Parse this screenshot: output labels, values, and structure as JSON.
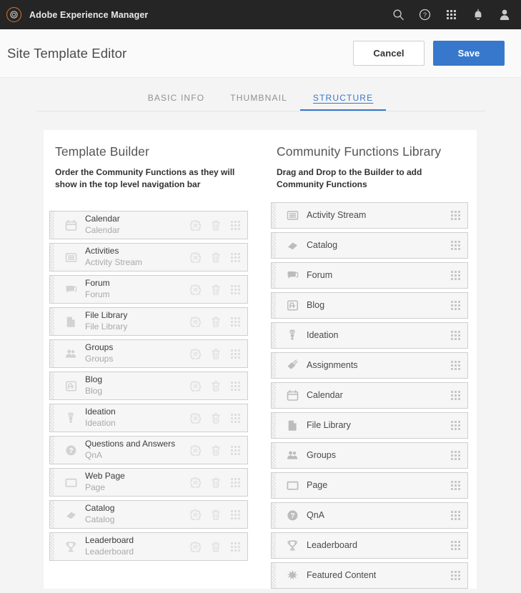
{
  "topbar": {
    "brand": "Adobe Experience Manager",
    "logo_color": "#e8731a",
    "icons": [
      {
        "name": "search-icon"
      },
      {
        "name": "help-icon"
      },
      {
        "name": "apps-grid-icon"
      },
      {
        "name": "notifications-bell-icon"
      },
      {
        "name": "user-avatar-icon"
      }
    ]
  },
  "header": {
    "title": "Site Template Editor",
    "cancel_label": "Cancel",
    "save_label": "Save",
    "save_color": "#3778cc"
  },
  "tabs": {
    "items": [
      {
        "label": "BASIC INFO",
        "active": false
      },
      {
        "label": "THUMBNAIL",
        "active": false
      },
      {
        "label": "STRUCTURE",
        "active": true
      }
    ],
    "active_color": "#3778cc"
  },
  "builder": {
    "title": "Template Builder",
    "description": "Order the Community Functions as they will show in the top level navigation bar",
    "actions": {
      "settings": "gear-icon",
      "delete": "trash-icon",
      "drag": "drag-handle-icon"
    },
    "items": [
      {
        "title": "Calendar",
        "subtitle": "Calendar",
        "icon": "calendar-icon"
      },
      {
        "title": "Activities",
        "subtitle": "Activity Stream",
        "icon": "activity-stream-icon"
      },
      {
        "title": "Forum",
        "subtitle": "Forum",
        "icon": "forum-icon"
      },
      {
        "title": "File Library",
        "subtitle": "File Library",
        "icon": "file-library-icon"
      },
      {
        "title": "Groups",
        "subtitle": "Groups",
        "icon": "groups-icon"
      },
      {
        "title": "Blog",
        "subtitle": "Blog",
        "icon": "blog-icon"
      },
      {
        "title": "Ideation",
        "subtitle": "Ideation",
        "icon": "ideation-icon"
      },
      {
        "title": "Questions and Answers",
        "subtitle": "QnA",
        "icon": "qna-icon"
      },
      {
        "title": "Web Page",
        "subtitle": "Page",
        "icon": "page-icon"
      },
      {
        "title": "Catalog",
        "subtitle": "Catalog",
        "icon": "catalog-icon"
      },
      {
        "title": "Leaderboard",
        "subtitle": "Leaderboard",
        "icon": "leaderboard-icon"
      }
    ]
  },
  "library": {
    "title": "Community Functions Library",
    "description": "Drag and Drop to the Builder to add Community Functions",
    "items": [
      {
        "title": "Activity Stream",
        "icon": "activity-stream-icon"
      },
      {
        "title": "Catalog",
        "icon": "catalog-icon"
      },
      {
        "title": "Forum",
        "icon": "forum-icon"
      },
      {
        "title": "Blog",
        "icon": "blog-icon"
      },
      {
        "title": "Ideation",
        "icon": "ideation-icon"
      },
      {
        "title": "Assignments",
        "icon": "assignments-icon"
      },
      {
        "title": "Calendar",
        "icon": "calendar-icon"
      },
      {
        "title": "File Library",
        "icon": "file-library-icon"
      },
      {
        "title": "Groups",
        "icon": "groups-icon"
      },
      {
        "title": "Page",
        "icon": "page-icon"
      },
      {
        "title": "QnA",
        "icon": "qna-icon"
      },
      {
        "title": "Leaderboard",
        "icon": "leaderboard-icon"
      },
      {
        "title": "Featured Content",
        "icon": "featured-content-icon"
      }
    ]
  }
}
